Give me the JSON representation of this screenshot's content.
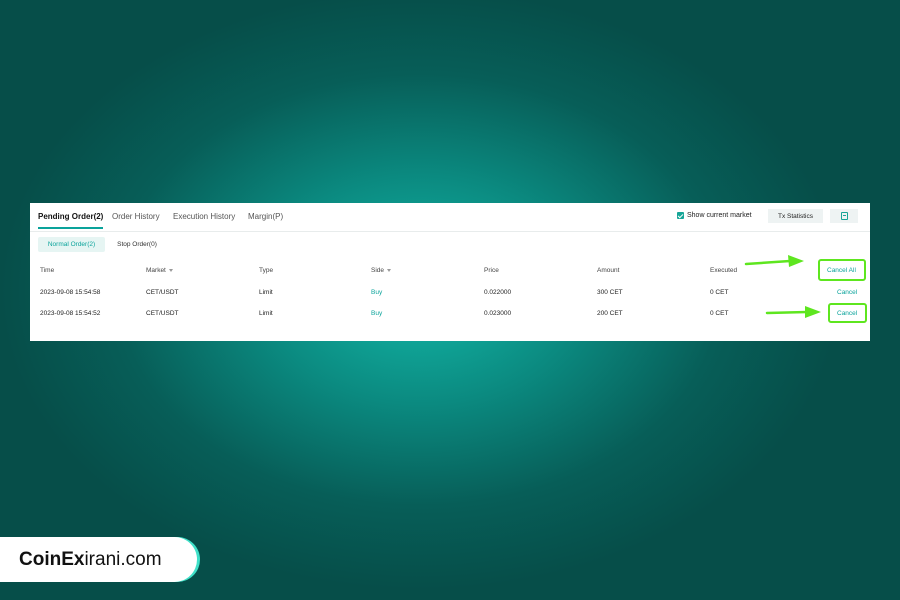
{
  "tabs": [
    {
      "label": "Pending Order(2)",
      "active": true
    },
    {
      "label": "Order History",
      "active": false
    },
    {
      "label": "Execution History",
      "active": false
    },
    {
      "label": "Margin(P)",
      "active": false
    }
  ],
  "toolbar": {
    "show_current_market": "Show current market",
    "show_current_market_checked": true,
    "tx_statistics": "Tx Statistics",
    "document_icon": "document-icon"
  },
  "subtabs": [
    {
      "label": "Normal Order(2)",
      "active": true
    },
    {
      "label": "Stop Order(0)",
      "active": false
    }
  ],
  "table": {
    "headers": [
      "Time",
      "Market",
      "Type",
      "Side",
      "Price",
      "Amount",
      "Executed"
    ],
    "cancel_all": "Cancel All",
    "rows": [
      {
        "time": "2023-09-08 15:54:58",
        "market": "CET/USDT",
        "type": "Limit",
        "side": "Buy",
        "price": "0.022000",
        "amount": "300 CET",
        "executed": "0 CET",
        "action": "Cancel"
      },
      {
        "time": "2023-09-08 15:54:52",
        "market": "CET/USDT",
        "type": "Limit",
        "side": "Buy",
        "price": "0.023000",
        "amount": "200 CET",
        "executed": "0 CET",
        "action": "Cancel"
      }
    ]
  },
  "colors": {
    "accent": "#0aa39b",
    "highlight": "#5ee61f",
    "background": "#0b8a80"
  },
  "brand": {
    "name_bold": "CoinEx",
    "name_rest": "irani.com"
  }
}
